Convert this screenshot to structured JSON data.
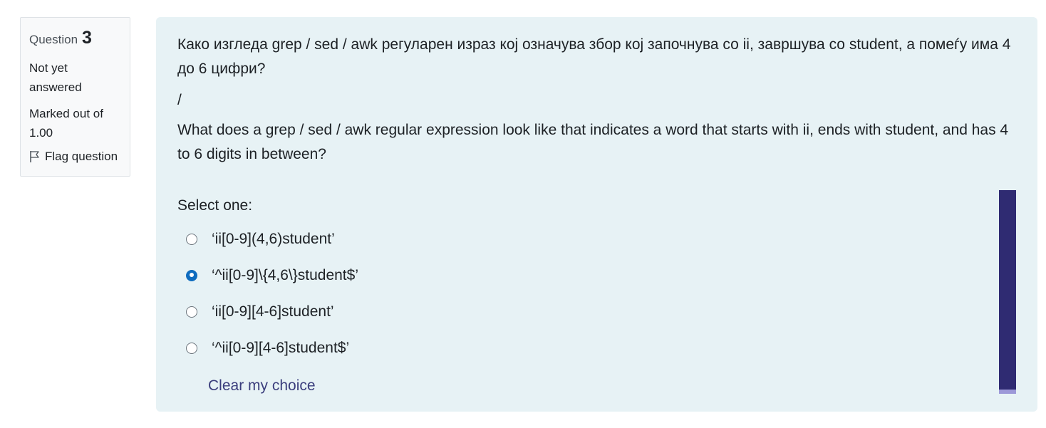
{
  "info": {
    "question_word": "Question",
    "question_number": "3",
    "state": "Not yet answered",
    "grade": "Marked out of 1.00",
    "flag_label": "Flag question",
    "flag_icon": "flag-icon"
  },
  "question": {
    "text_mk": "Како изгледа grep / sed / awk регуларен израз кој означува збор кој започнува со ii, завршува со student, а помеѓу има 4 до 6 цифри?",
    "separator": "/",
    "text_en": "What does a grep / sed / awk regular expression look like that indicates a word that starts with ii, ends with student, and has 4 to 6 digits in between?",
    "prompt": "Select one:",
    "answers": [
      {
        "label": "‘ii[0-9](4,6)student’",
        "checked": false
      },
      {
        "label": "‘^ii[0-9]\\{4,6\\}student$’",
        "checked": true
      },
      {
        "label": "‘ii[0-9][4-6]student’",
        "checked": false
      },
      {
        "label": "‘^ii[0-9][4-6]student$’",
        "checked": false
      }
    ],
    "clear_label": "Clear my choice"
  },
  "colors": {
    "panel_bg": "#e7f2f5",
    "accent": "#0f6cbf",
    "link": "#3a3d7c",
    "vbar": "#2f2b72"
  }
}
